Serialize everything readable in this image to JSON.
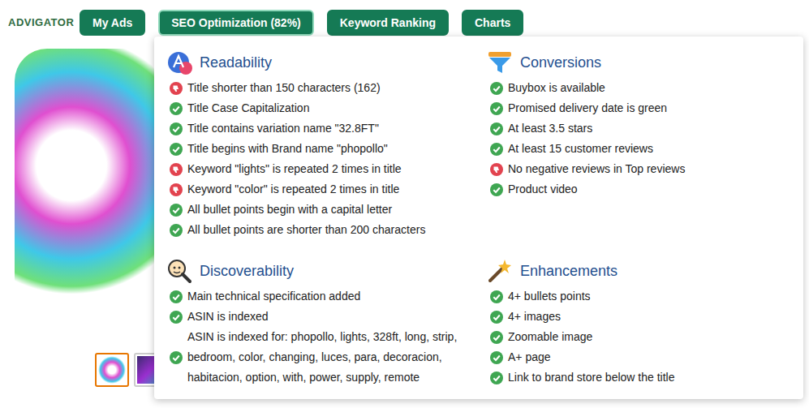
{
  "logo": "ADVIGATOR",
  "nav": [
    {
      "label": "My Ads",
      "selected": false
    },
    {
      "label": "SEO Optimization (82%)",
      "selected": true
    },
    {
      "label": "Keyword Ranking",
      "selected": false
    },
    {
      "label": "Charts",
      "selected": false
    }
  ],
  "thumbnails": [
    {
      "selected": true
    },
    {
      "selected": false
    }
  ],
  "sections": [
    {
      "title": "Readability",
      "kind": "readability",
      "items": [
        {
          "text": "Title shorter than 150 characters (162)",
          "passed": false
        },
        {
          "text": "Title Case Capitalization",
          "passed": true
        },
        {
          "text": "Title contains variation name \"32.8FT\"",
          "passed": true
        },
        {
          "text": "Title begins with Brand name \"phopollo\"",
          "passed": true
        },
        {
          "text": "Keyword \"lights\" is repeated 2 times in title",
          "passed": false
        },
        {
          "text": "Keyword \"color\" is repeated 2 times in title",
          "passed": false
        },
        {
          "text": "All bullet points begin with a capital letter",
          "passed": true
        },
        {
          "text": "All bullet points are shorter than 200 characters",
          "passed": true
        }
      ]
    },
    {
      "title": "Conversions",
      "kind": "conversions",
      "items": [
        {
          "text": "Buybox is available",
          "passed": true
        },
        {
          "text": "Promised delivery date is green",
          "passed": true
        },
        {
          "text": "At least 3.5 stars",
          "passed": true
        },
        {
          "text": "At least 15 customer reviews",
          "passed": true
        },
        {
          "text": "No negative reviews in Top reviews",
          "passed": false
        },
        {
          "text": "Product video",
          "passed": true
        }
      ]
    },
    {
      "title": "Discoverability",
      "kind": "discoverability",
      "items": [
        {
          "text": "Main technical specification added",
          "passed": true
        },
        {
          "text": "ASIN is indexed",
          "passed": true
        },
        {
          "text": "ASIN is indexed for: phopollo, lights, 328ft, long, strip, bedroom, color, changing, luces, para, decoracion, habitacion, option, with, power, supply, remote",
          "passed": true
        }
      ]
    },
    {
      "title": "Enhancements",
      "kind": "enhancements",
      "items": [
        {
          "text": "4+ bullets points",
          "passed": true
        },
        {
          "text": "4+ images",
          "passed": true
        },
        {
          "text": "Zoomable image",
          "passed": true
        },
        {
          "text": "A+ page",
          "passed": true
        },
        {
          "text": "Link to brand store below the title",
          "passed": true
        }
      ]
    }
  ]
}
